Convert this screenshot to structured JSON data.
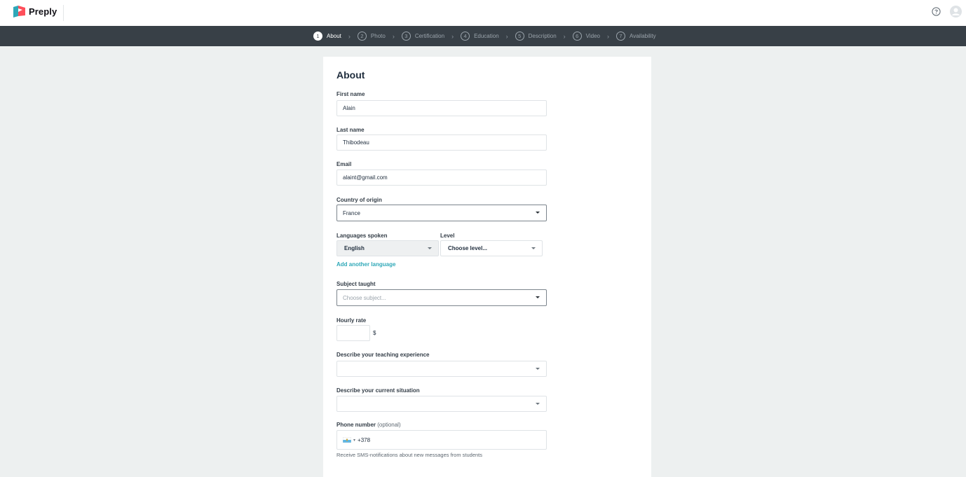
{
  "app": {
    "name": "Preply"
  },
  "steps": [
    {
      "num": "1",
      "label": "About"
    },
    {
      "num": "2",
      "label": "Photo"
    },
    {
      "num": "3",
      "label": "Certification"
    },
    {
      "num": "4",
      "label": "Education"
    },
    {
      "num": "5",
      "label": "Description"
    },
    {
      "num": "6",
      "label": "Video"
    },
    {
      "num": "7",
      "label": "Availability"
    }
  ],
  "form": {
    "title": "About",
    "first_name": {
      "label": "First name",
      "value": "Alain"
    },
    "last_name": {
      "label": "Last name",
      "value": "Thibodeau"
    },
    "email": {
      "label": "Email",
      "value": "alaint@gmail.com"
    },
    "country": {
      "label": "Country of origin",
      "value": "France"
    },
    "languages": {
      "label": "Languages spoken",
      "value": "English"
    },
    "level": {
      "label": "Level",
      "value": "Choose level..."
    },
    "add_language": "Add another language",
    "subject": {
      "label": "Subject taught",
      "placeholder": "Choose subject..."
    },
    "hourly_rate": {
      "label": "Hourly rate",
      "currency": "$"
    },
    "teaching_experience": {
      "label": "Describe your teaching experience"
    },
    "current_situation": {
      "label": "Describe your current situation"
    },
    "phone": {
      "label": "Phone number",
      "optional": "(optional)",
      "code": "+378"
    },
    "sms_note": "Receive SMS-notifications about new messages from students"
  },
  "colors": {
    "accent": "#2fa8b8",
    "stepbar": "#384047",
    "background": "#edf0f0"
  }
}
